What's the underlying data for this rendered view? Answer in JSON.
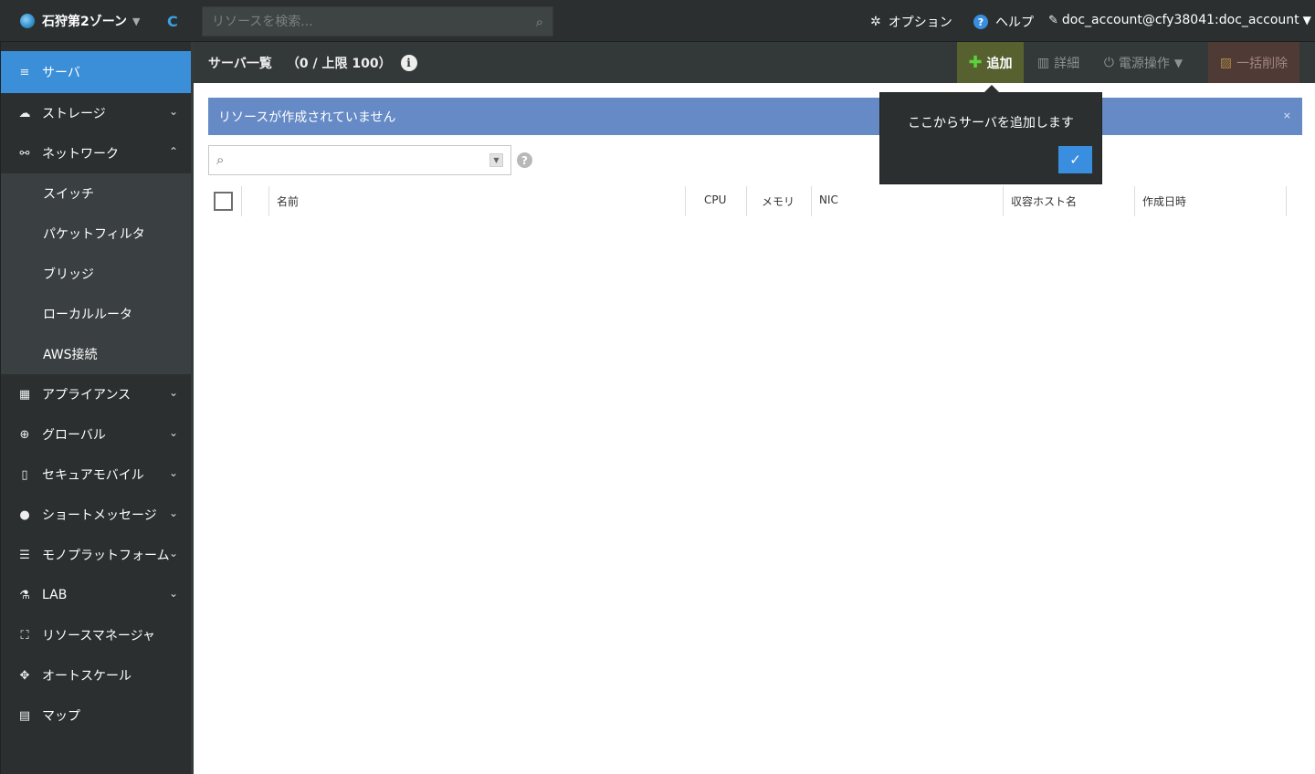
{
  "topbar": {
    "zone_label": "石狩第2ゾーン",
    "zone_caret": "▼",
    "refresh_glyph": "C",
    "search_placeholder": "リソースを検索...",
    "search_glyph": "⌕",
    "options_glyph": "✲",
    "options_label": "オプション",
    "help_glyph": "?",
    "help_label": "ヘルプ",
    "account_glyph": "✎",
    "account_label": "doc_account@cfy38041:doc_account",
    "account_caret": "▼"
  },
  "sidebar": {
    "items": [
      {
        "label": "サーバ",
        "icon": "≡"
      },
      {
        "label": "ストレージ",
        "icon": "☁",
        "chevron": "⌄"
      },
      {
        "label": "ネットワーク",
        "icon": "⚯",
        "chevron": "⌃"
      }
    ],
    "network_sub": [
      {
        "label": "スイッチ"
      },
      {
        "label": "パケットフィルタ"
      },
      {
        "label": "ブリッジ"
      },
      {
        "label": "ローカルルータ"
      },
      {
        "label": "AWS接続"
      }
    ],
    "rest": [
      {
        "label": "アプライアンス",
        "icon": "▦",
        "chevron": "⌄"
      },
      {
        "label": "グローバル",
        "icon": "⊕",
        "chevron": "⌄"
      },
      {
        "label": "セキュアモバイル",
        "icon": "▯",
        "chevron": "⌄"
      },
      {
        "label": "ショートメッセージ",
        "icon": "●",
        "chevron": "⌄"
      },
      {
        "label": "モノプラットフォーム",
        "icon": "☰",
        "chevron": "⌄"
      },
      {
        "label": "LAB",
        "icon": "⚗",
        "chevron": "⌄"
      },
      {
        "label": "リソースマネージャ",
        "icon": "⛶"
      },
      {
        "label": "オートスケール",
        "icon": "✥"
      },
      {
        "label": "マップ",
        "icon": "▤"
      }
    ]
  },
  "toolbar": {
    "title": "サーバ一覧",
    "count": "（0 / 上限 100）",
    "info_glyph": "i",
    "add_glyph": "✚",
    "add_label": "追加",
    "detail_glyph": "▥",
    "detail_label": "詳細",
    "power_glyph": "⏻",
    "power_label": "電源操作",
    "power_caret": "▼",
    "bulk_glyph": "▨",
    "bulk_label": "一括削除"
  },
  "alert": {
    "message": "リソースが作成されていません",
    "close_glyph": "×"
  },
  "filter": {
    "search_glyph": "⌕",
    "dropdown_glyph": "▼",
    "help_glyph": "?"
  },
  "table": {
    "columns": [
      "名前",
      "CPU",
      "メモリ",
      "NIC",
      "収容ホスト名",
      "作成日時"
    ]
  },
  "tooltip": {
    "text": "ここからサーバを追加します",
    "ok_glyph": "✓"
  }
}
